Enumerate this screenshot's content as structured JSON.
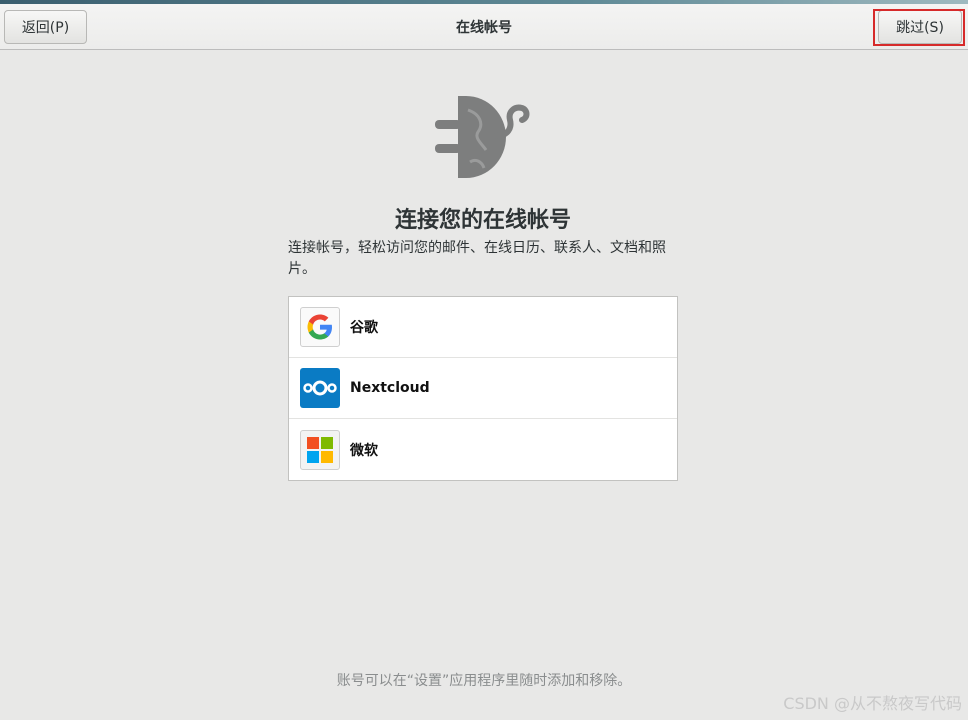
{
  "header": {
    "back_label": "返回(P)",
    "title": "在线帐号",
    "skip_label": "跳过(S)"
  },
  "main": {
    "heading": "连接您的在线帐号",
    "description": "连接帐号，轻松访问您的邮件、在线日历、联系人、文档和照片。",
    "providers": [
      {
        "label": "谷歌",
        "icon": "google-icon"
      },
      {
        "label": "Nextcloud",
        "icon": "nextcloud-icon"
      },
      {
        "label": "微软",
        "icon": "microsoft-icon"
      }
    ]
  },
  "footer": {
    "note": "账号可以在“设置”应用程序里随时添加和移除。"
  },
  "watermark": "CSDN @从不熬夜写代码",
  "colors": {
    "highlight": "#d62a2a",
    "nextcloud_blue": "#0a7bc4",
    "google_blue": "#4285f4",
    "google_red": "#ea4335",
    "google_yellow": "#fbbc05",
    "google_green": "#34a853"
  }
}
